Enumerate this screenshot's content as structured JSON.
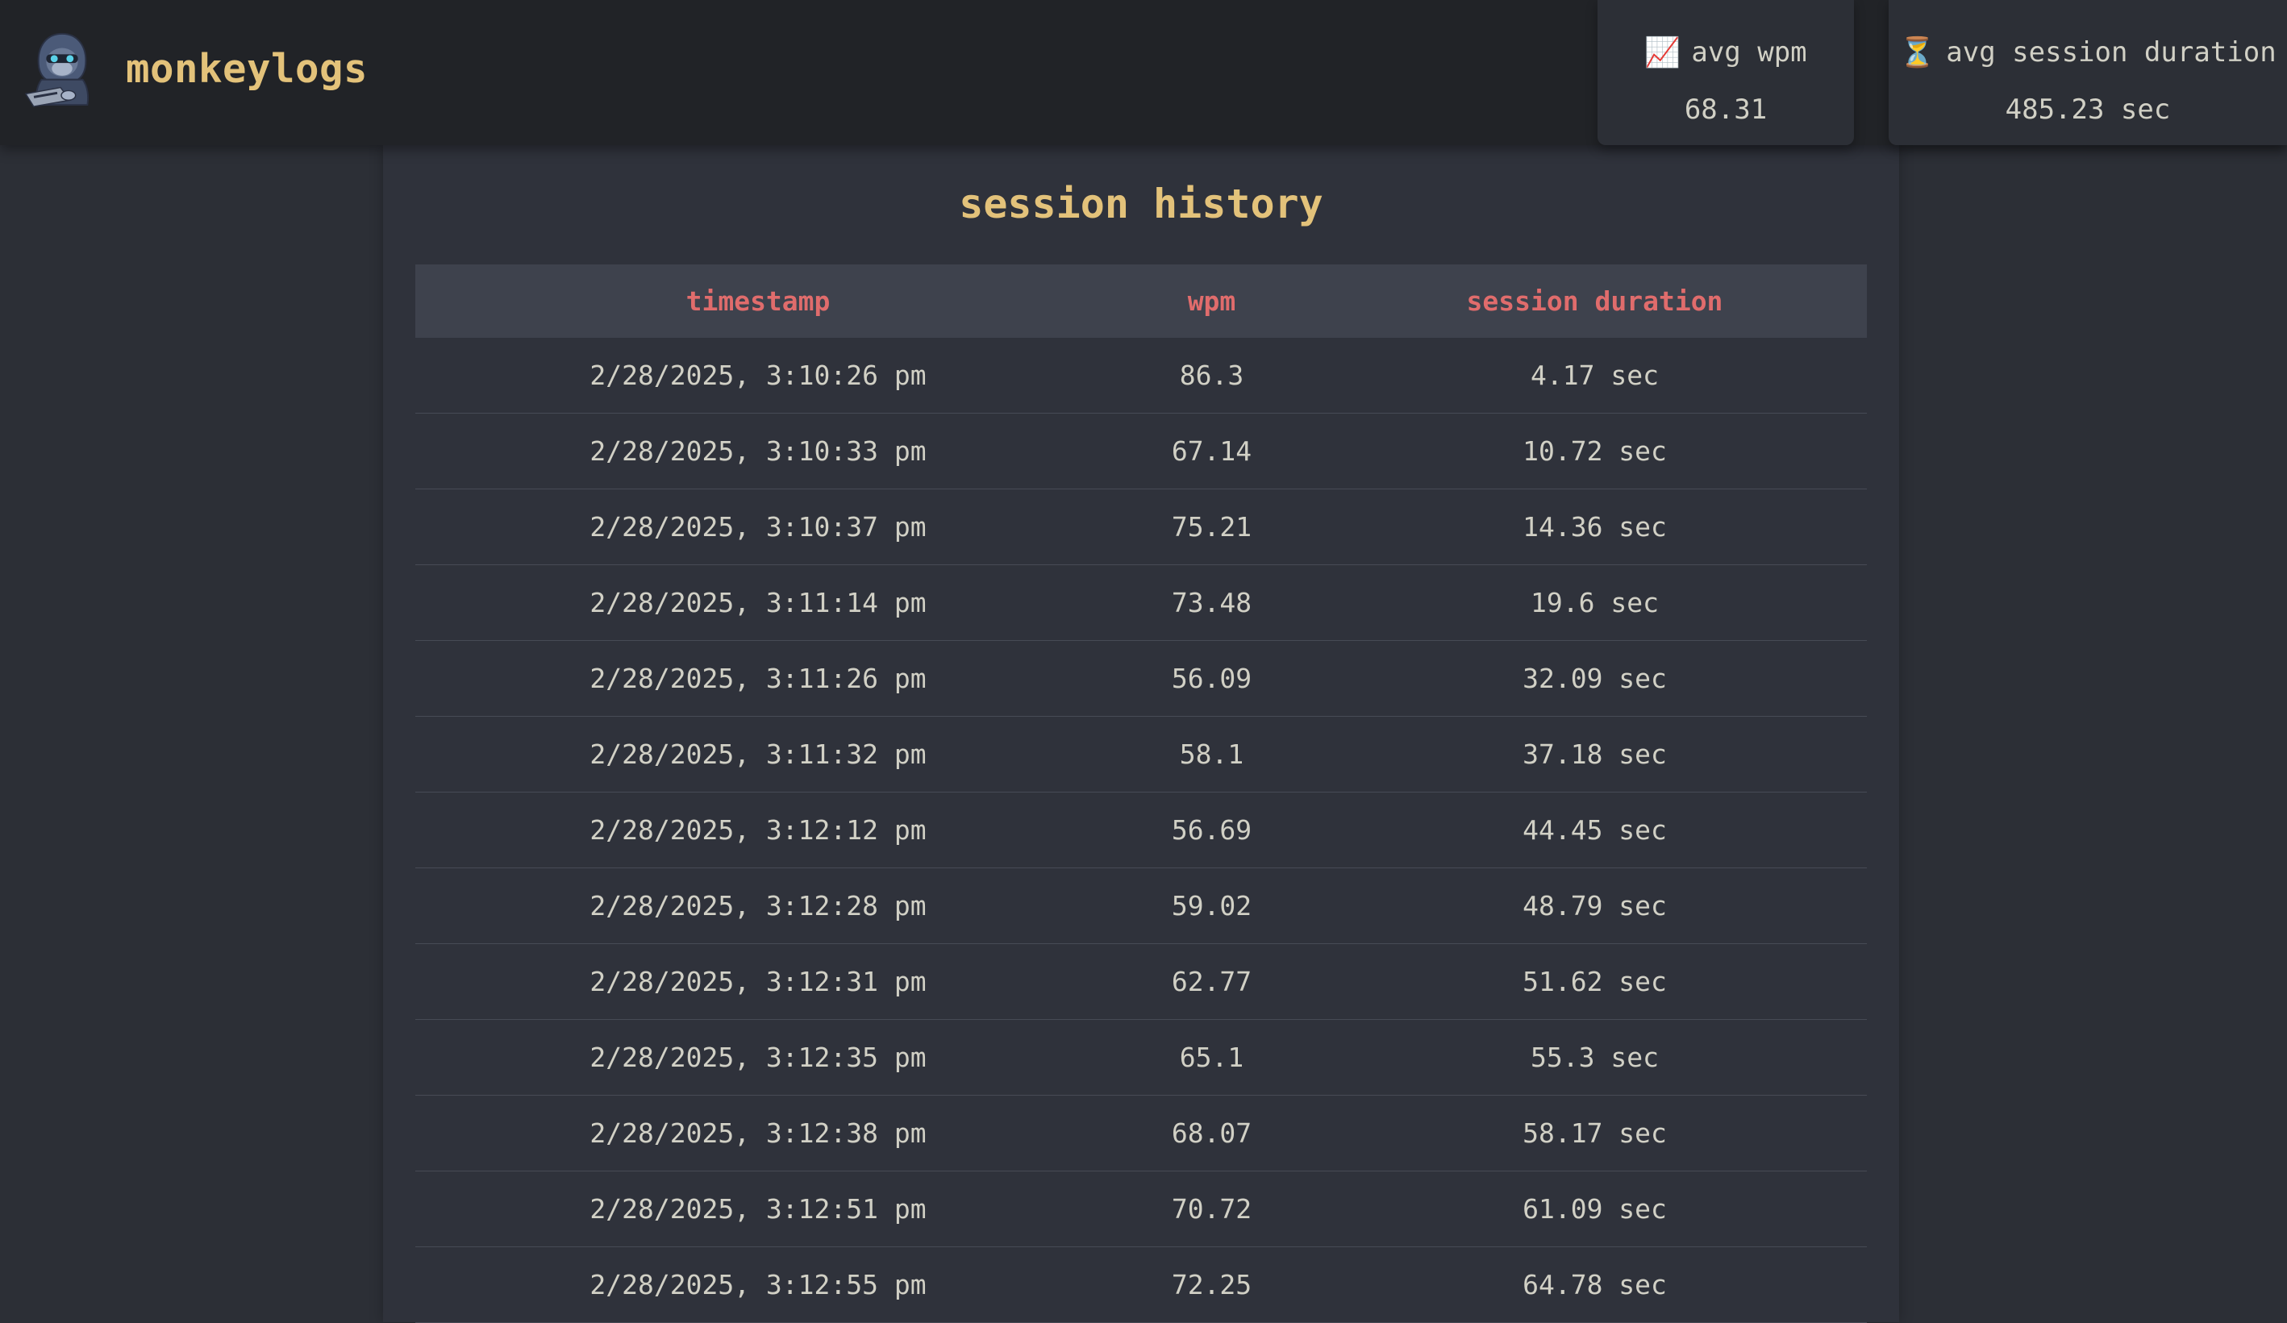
{
  "app": {
    "title": "monkeylogs",
    "logo_icon": "monkey-hacker-logo"
  },
  "stats": {
    "avg_wpm": {
      "icon": "chart-increasing-icon",
      "label": "avg wpm",
      "value": "68.31"
    },
    "avg_session_duration": {
      "icon": "hourglass-icon",
      "label": "avg session duration",
      "value": "485.23 sec"
    }
  },
  "history": {
    "title": "session history",
    "columns": [
      "timestamp",
      "wpm",
      "session duration"
    ],
    "rows": [
      [
        "2/28/2025, 3:10:26 pm",
        "86.3",
        "4.17 sec"
      ],
      [
        "2/28/2025, 3:10:33 pm",
        "67.14",
        "10.72 sec"
      ],
      [
        "2/28/2025, 3:10:37 pm",
        "75.21",
        "14.36 sec"
      ],
      [
        "2/28/2025, 3:11:14 pm",
        "73.48",
        "19.6 sec"
      ],
      [
        "2/28/2025, 3:11:26 pm",
        "56.09",
        "32.09 sec"
      ],
      [
        "2/28/2025, 3:11:32 pm",
        "58.1",
        "37.18 sec"
      ],
      [
        "2/28/2025, 3:12:12 pm",
        "56.69",
        "44.45 sec"
      ],
      [
        "2/28/2025, 3:12:28 pm",
        "59.02",
        "48.79 sec"
      ],
      [
        "2/28/2025, 3:12:31 pm",
        "62.77",
        "51.62 sec"
      ],
      [
        "2/28/2025, 3:12:35 pm",
        "65.1",
        "55.3 sec"
      ],
      [
        "2/28/2025, 3:12:38 pm",
        "68.07",
        "58.17 sec"
      ],
      [
        "2/28/2025, 3:12:51 pm",
        "70.72",
        "61.09 sec"
      ],
      [
        "2/28/2025, 3:12:55 pm",
        "72.25",
        "64.78 sec"
      ]
    ]
  },
  "colors": {
    "accent": "#e3c27a",
    "header_text": "#e06c6c",
    "background": "#2c2f36",
    "text": "#d1d0c5"
  }
}
